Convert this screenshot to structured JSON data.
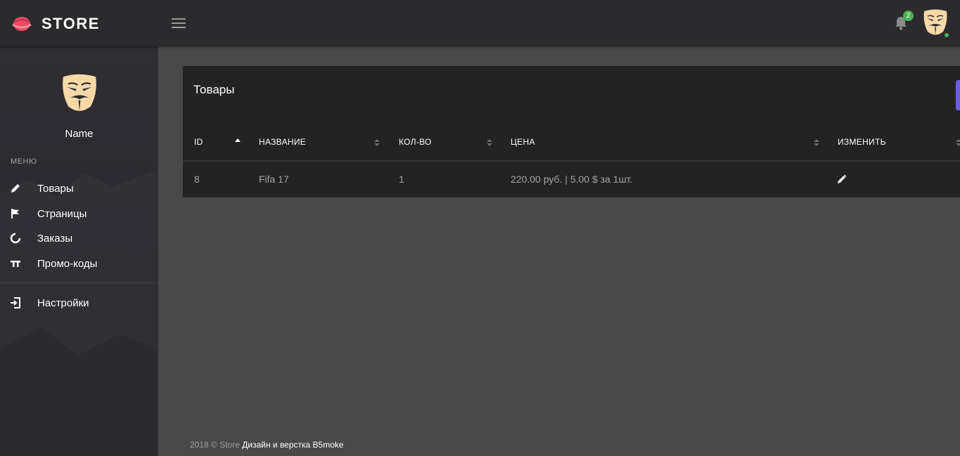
{
  "brand": {
    "title": "STORE",
    "accent": "#e94b63"
  },
  "header": {
    "notifications_count": "2",
    "status_color": "#4caf50"
  },
  "sidebar": {
    "user_name": "Name",
    "menu_caption": "МЕНЮ",
    "items": [
      {
        "label": "Товары",
        "icon": "pencil-icon"
      },
      {
        "label": "Страницы",
        "icon": "flag-icon"
      },
      {
        "label": "Заказы",
        "icon": "circle-notch-icon"
      },
      {
        "label": "Промо-коды",
        "icon": "text-height-icon"
      }
    ],
    "settings": {
      "label": "Настройки",
      "icon": "sign-in-icon"
    }
  },
  "products": {
    "title": "Товары",
    "action_color": "#6c5ce7",
    "columns": [
      "ID",
      "Название",
      "Кол-во",
      "Цена",
      "Изменить"
    ],
    "rows": [
      {
        "id": "8",
        "name": "Fifa 17",
        "qty": "1",
        "price": "220.00 руб. | 5.00 $ за 1шт.",
        "edit_icon": "pencil-icon"
      }
    ]
  },
  "footer": {
    "copyright": "2018 © Store",
    "credit": "Дизайн и верстка B5moke"
  }
}
